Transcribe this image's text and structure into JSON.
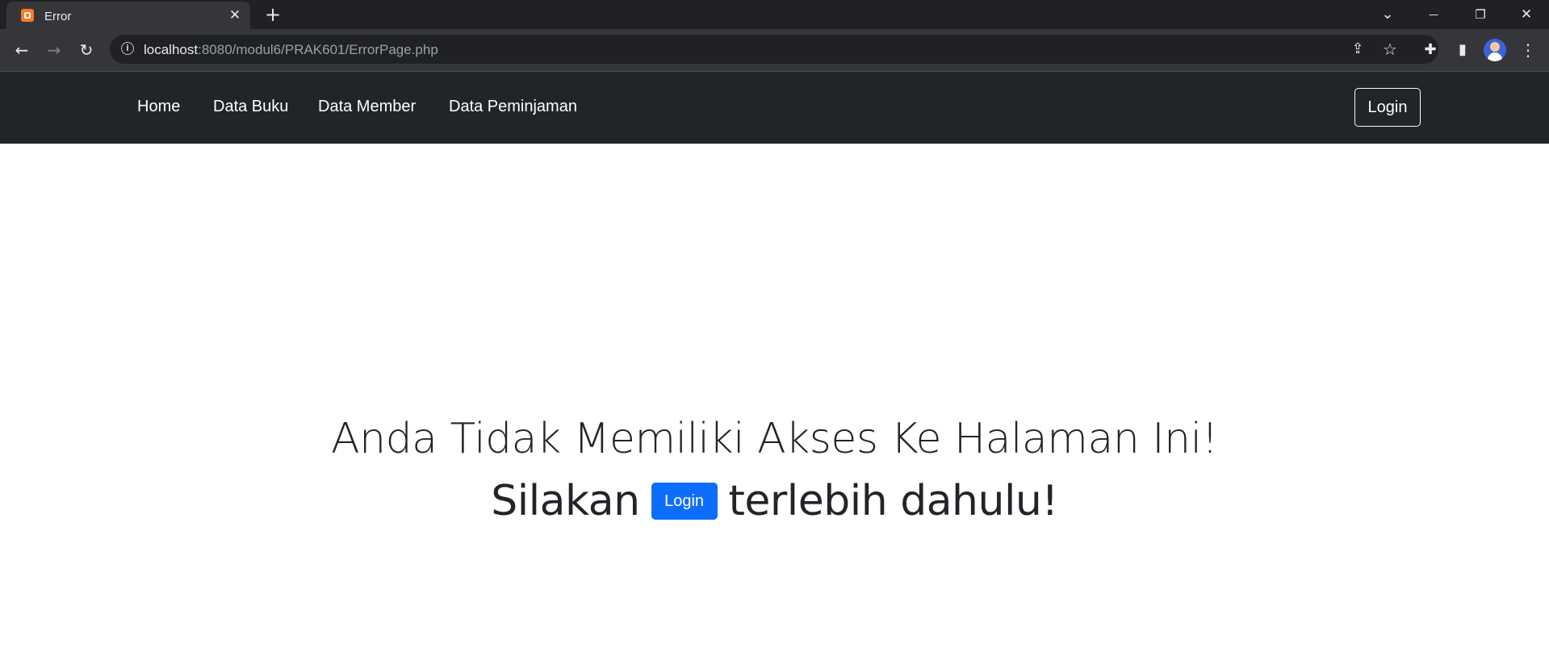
{
  "browser": {
    "tab_title": "Error",
    "tab_close": "✕",
    "new_tab": "+",
    "url_host": "localhost",
    "url_path": ":8080/modul6/PRAK601/ErrorPage.php",
    "window_controls": {
      "tab_search": "⌄",
      "minimize": "—",
      "restore": "❐",
      "close": "✕"
    },
    "toolbar_icons": {
      "back": "←",
      "forward": "→",
      "reload": "↻",
      "share": "⇪",
      "bookmark": "☆",
      "extensions": "✚",
      "side_panel": "▮",
      "menu": "⋮"
    }
  },
  "navbar": {
    "links": [
      "Home",
      "Data Buku",
      "Data Member",
      "Data Peminjaman"
    ],
    "login_label": "Login"
  },
  "main": {
    "heading": "Anda Tidak Memiliki Akses Ke Halaman Ini!",
    "line2_before": "Silakan",
    "login_button": "Login",
    "line2_after": "terlebih dahulu!"
  },
  "colors": {
    "navbar_bg": "#212529",
    "primary": "#0d6efd",
    "favicon": "#fb7a24"
  }
}
